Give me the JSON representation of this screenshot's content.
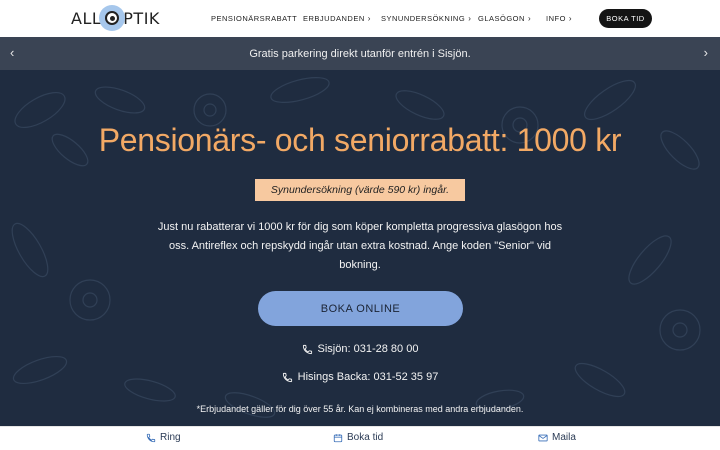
{
  "header": {
    "logo": {
      "prefix": "ALL",
      "suffix": "PTIK"
    },
    "nav": [
      {
        "label": "PENSIONÄRSRABATT",
        "chevron": ""
      },
      {
        "label": "ERBJUDANDEN",
        "chevron": "›"
      },
      {
        "label": "SYNUNDERSÖKNING",
        "chevron": "›"
      },
      {
        "label": "GLASÖGON",
        "chevron": "›"
      },
      {
        "label": "INFO",
        "chevron": "›"
      }
    ],
    "cta": "BOKA TID"
  },
  "announcement": {
    "text": "Gratis parkering direkt utanför entrén i Sisjön.",
    "prev": "‹",
    "next": "›"
  },
  "hero": {
    "title": "Pensionärs- och seniorrabatt: 1000 kr",
    "badge": "Synundersökning (värde 590 kr) ingår.",
    "body": "Just nu rabatterar vi 1000 kr för dig som köper kompletta progressiva glasögon hos oss. Antireflex och repskydd ingår utan extra kostnad. Ange koden \"Senior\" vid bokning.",
    "button": "BOKA ONLINE",
    "phones": [
      {
        "label": "Sisjön: 031-28 80 00"
      },
      {
        "label": "Hisings Backa: 031-52 35 97"
      }
    ],
    "disclaimer": "*Erbjudandet gäller för dig över 55 år. Kan ej kombineras med andra erbjudanden."
  },
  "bottom_bar": {
    "ring": "Ring",
    "boka": "Boka tid",
    "maila": "Maila"
  },
  "colors": {
    "hero_bg": "#1f2c40",
    "title": "#f2a965",
    "badge_bg": "#f7c9a0",
    "button_bg": "#82a4dc",
    "announce_bg": "#3a4454"
  }
}
